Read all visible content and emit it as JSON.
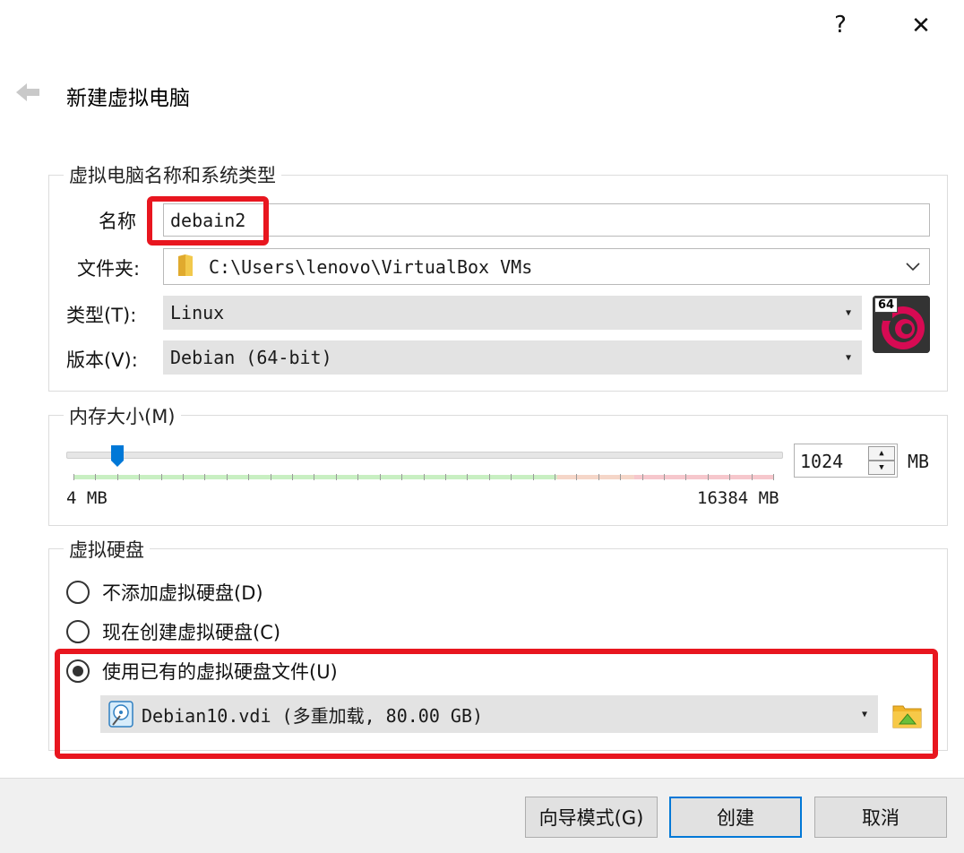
{
  "window": {
    "help_label": "?",
    "close_label": "✕"
  },
  "header": {
    "title": "新建虚拟电脑"
  },
  "name_os_group": {
    "title": "虚拟电脑名称和系统类型",
    "name_label": "名称",
    "name_value": "debain2",
    "folder_label": "文件夹:",
    "folder_value": "C:\\Users\\lenovo\\VirtualBox VMs",
    "type_label": "类型(T):",
    "type_value": "Linux",
    "version_label": "版本(V):",
    "version_value": "Debian (64-bit)",
    "os_badge": "64"
  },
  "memory_group": {
    "title": "内存大小(M)",
    "min_label": "4 MB",
    "max_label": "16384 MB",
    "value": "1024",
    "unit": "MB",
    "slider_fraction": 0.0623
  },
  "disk_group": {
    "title": "虚拟硬盘",
    "options": [
      {
        "label": "不添加虚拟硬盘(D)",
        "checked": false
      },
      {
        "label": "现在创建虚拟硬盘(C)",
        "checked": false
      },
      {
        "label": "使用已有的虚拟硬盘文件(U)",
        "checked": true
      }
    ],
    "selected_disk": "Debian10.vdi (多重加载, 80.00 GB)"
  },
  "footer": {
    "guide_label": "向导模式(G)",
    "create_label": "创建",
    "cancel_label": "取消"
  },
  "colors": {
    "accent": "#0078d7",
    "annotation_red": "#e8161f",
    "combo_bg": "#e3e3e3"
  }
}
